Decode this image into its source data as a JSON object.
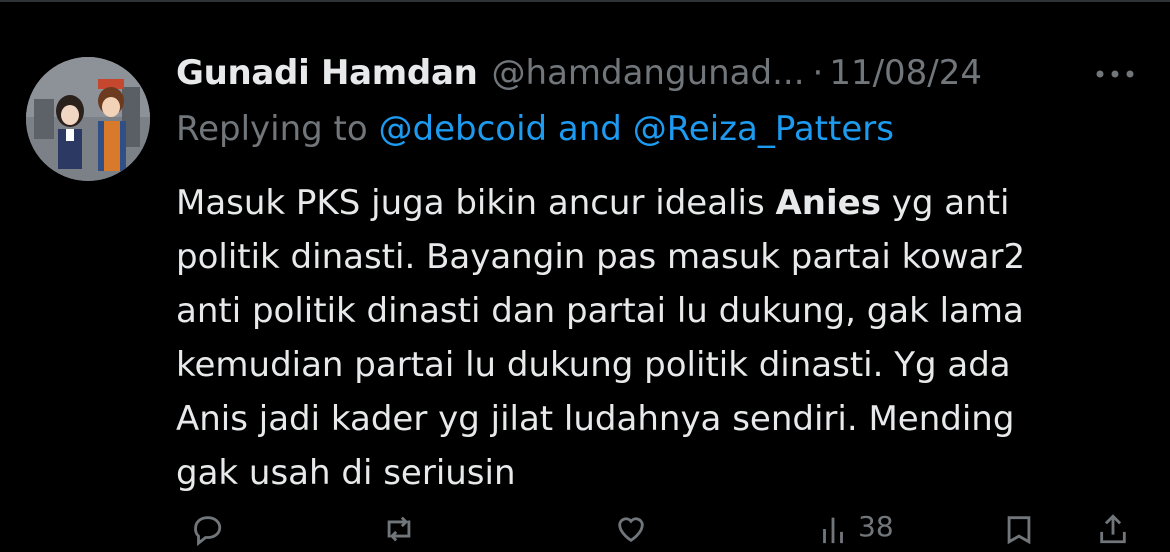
{
  "tweet": {
    "author_name": "Gunadi Hamdan",
    "handle": "@hamdangunad...",
    "separator": "·",
    "date": "11/08/24",
    "more_icon": "more-horizontal-icon",
    "replying_prefix": "Replying to ",
    "reply_mention_1": "@debcoid",
    "reply_and": " and ",
    "reply_mention_2": "@Reiza_Patters",
    "body_lines": [
      {
        "pre": "Masuk PKS juga bikin ancur idealis ",
        "bold": "Anies",
        "post": " yg anti"
      },
      {
        "text": "politik dinasti. Bayangin pas masuk partai kowar2"
      },
      {
        "text": "anti politik dinasti dan partai lu dukung, gak lama"
      },
      {
        "text": "kemudian partai lu dukung politik dinasti. Yg ada"
      },
      {
        "text": "Anis jadi kader yg jilat ludahnya sendiri. Mending"
      },
      {
        "text": "gak usah di seriusin"
      }
    ],
    "actions": {
      "reply_icon": "reply-icon",
      "retweet_icon": "retweet-icon",
      "like_icon": "heart-icon",
      "views_icon": "views-icon",
      "views_count": "38",
      "bookmark_icon": "bookmark-icon",
      "share_icon": "share-icon"
    }
  },
  "colors": {
    "background": "#000000",
    "text_primary": "#e7e9ea",
    "text_secondary": "#71767b",
    "link": "#1d9bf0"
  }
}
